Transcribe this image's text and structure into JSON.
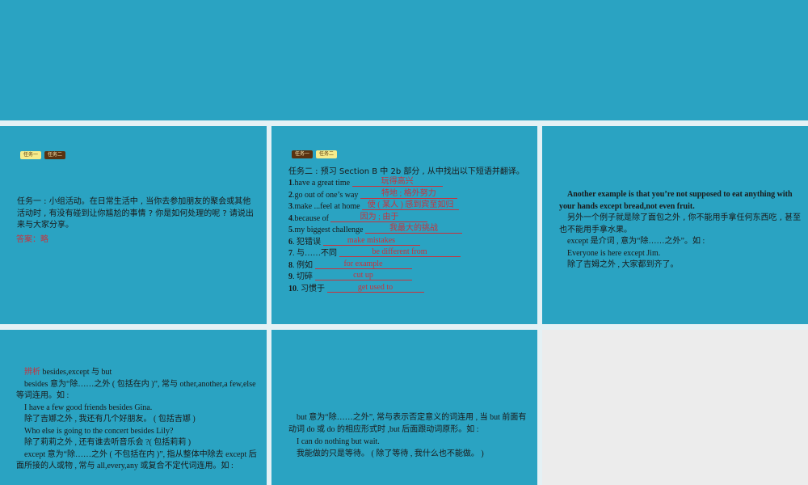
{
  "slide2": {
    "tabs": [
      "任务一",
      "任务二"
    ],
    "task": "任务一 : 小组活动。在日常生活中 , 当你去参加朋友的聚会或其他活动时 , 有没有碰到让你尴尬的事情 ? 你是如何处理的呢 ? 请说出来与大家分享。",
    "answer": "答案：略"
  },
  "slide3": {
    "tabs": [
      "任务一",
      "任务二"
    ],
    "title": "任务二 : 预习 Section B  中 2b 部分 , 从中找出以下短语并翻译。",
    "items": [
      {
        "num": "1",
        "prompt": ".have a great time",
        "answer": "玩得高兴"
      },
      {
        "num": "2",
        "prompt": ".go out of one’s way",
        "answer": "特地 ; 格外努力"
      },
      {
        "num": "3",
        "prompt": ".make ...feel at home",
        "answer": "使 ( 某人 ) 感到宾至如归"
      },
      {
        "num": "4",
        "prompt": ".because of",
        "answer": "因为 ; 由于"
      },
      {
        "num": "5",
        "prompt": ".my biggest challenge",
        "answer": "我最大的挑战"
      },
      {
        "num": "6",
        "prompt": ". 犯错误",
        "answer": "make mistakes"
      },
      {
        "num": "7",
        "prompt": ". 与……不同",
        "answer": "be different from"
      },
      {
        "num": "8",
        "prompt": ". 例如",
        "answer": "for example"
      },
      {
        "num": "9",
        "prompt": ". 切碎",
        "answer": "cut up"
      },
      {
        "num": "10",
        "prompt": ". 习惯于",
        "answer": "get used to"
      }
    ]
  },
  "slide4": {
    "en": "Another example is that you’re not supposed to eat anything with your hands except bread,not even fruit.",
    "zh": "另外一个例子就是除了面包之外 , 你不能用手拿任何东西吃 , 甚至也不能用手拿水果。",
    "note": "except 是介词 , 意为“除……之外”。如 :",
    "ex_en": "Everyone is here except Jim.",
    "ex_zh": "除了吉姆之外 , 大家都到齐了。"
  },
  "slide5": {
    "label": "辨析",
    "heading": "besides,except 与 but",
    "lines": [
      "besides 意为“除……之外 ( 包括在内 )”, 常与 other,another,a few,else 等词连用。如 :",
      "I have a few good friends besides Gina.",
      "除了吉娜之外 , 我还有几个好朋友。 ( 包括吉娜 )",
      "Who else is going to the concert besides Lily?",
      "除了莉莉之外 , 还有谁去听音乐会 ?( 包括莉莉 )",
      "except 意为“除……之外 ( 不包括在内 )”, 指从整体中除去 except 后面所接的人或物 , 常与 all,every,any 或复合不定代词连用。如 :"
    ]
  },
  "slide6": {
    "lines": [
      "but 意为“除……之外”, 常与表示否定意义的词连用 , 当 but 前面有动词 do 或 do 的相应形式时 ,but 后面跟动词原形。如 :",
      "I can do nothing but wait.",
      "我能做的只是等待。 ( 除了等待 , 我什么也不能做。 )"
    ]
  }
}
